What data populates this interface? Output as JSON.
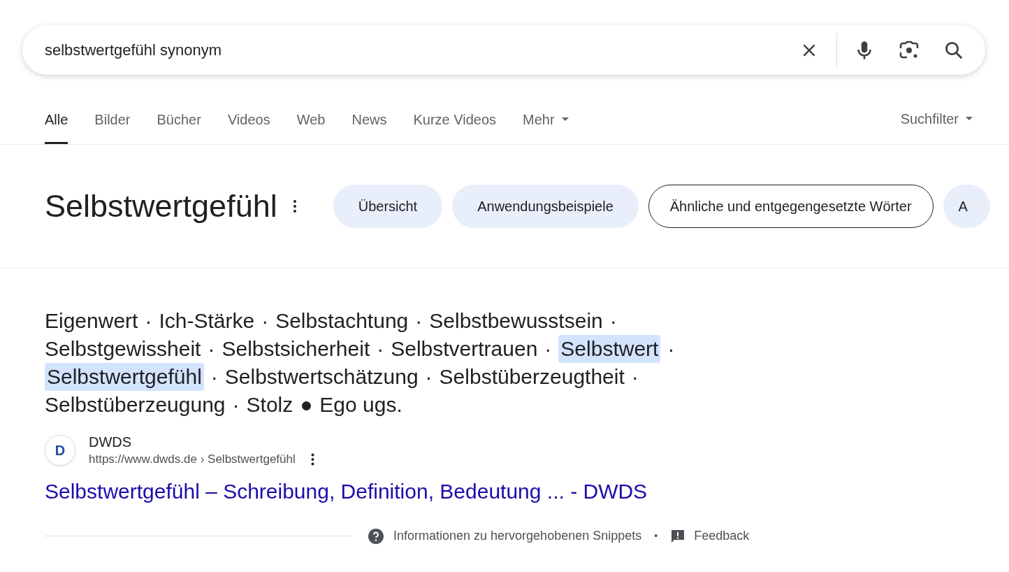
{
  "search": {
    "value": "selbstwertgefühl synonym"
  },
  "tabs": [
    {
      "label": "Alle",
      "selected": true
    },
    {
      "label": "Bilder",
      "selected": false
    },
    {
      "label": "Bücher",
      "selected": false
    },
    {
      "label": "Videos",
      "selected": false
    },
    {
      "label": "Web",
      "selected": false
    },
    {
      "label": "News",
      "selected": false
    },
    {
      "label": "Kurze Videos",
      "selected": false
    },
    {
      "label": "Mehr",
      "selected": false,
      "dropdown": true
    }
  ],
  "filter": {
    "label": "Suchfilter"
  },
  "heading": {
    "title": "Selbstwertgefühl"
  },
  "chips": [
    {
      "label": "Übersicht",
      "selected": false
    },
    {
      "label": "Anwendungsbeispiele",
      "selected": false
    },
    {
      "label": "Ähnliche und entgegengesetzte Wörter",
      "selected": true
    },
    {
      "label": "A",
      "selected": false
    }
  ],
  "synonyms": [
    {
      "word": "Eigenwert",
      "highlighted": false,
      "separator": "·"
    },
    {
      "word": "Ich-Stärke",
      "highlighted": false,
      "separator": "·"
    },
    {
      "word": "Selbstachtung",
      "highlighted": false,
      "separator": "·"
    },
    {
      "word": "Selbstbewusstsein",
      "highlighted": false,
      "separator": "·"
    },
    {
      "word": "Selbstgewissheit",
      "highlighted": false,
      "separator": "·"
    },
    {
      "word": "Selbstsicherheit",
      "highlighted": false,
      "separator": "·"
    },
    {
      "word": "Selbstvertrauen",
      "highlighted": false,
      "separator": "·"
    },
    {
      "word": "Selbstwert",
      "highlighted": true,
      "separator": "·"
    },
    {
      "word": "Selbstwertgefühl",
      "highlighted": true,
      "separator": "·"
    },
    {
      "word": "Selbstwertschätzung",
      "highlighted": false,
      "separator": "·"
    },
    {
      "word": "Selbstüberzeugtheit",
      "highlighted": false,
      "separator": "·"
    },
    {
      "word": "Selbstüberzeugung",
      "highlighted": false,
      "separator": "·"
    },
    {
      "word": "Stolz",
      "highlighted": false,
      "separator": "●"
    },
    {
      "word": "Ego ugs.",
      "highlighted": false
    }
  ],
  "source": {
    "favicon_letter": "D",
    "name": "DWDS",
    "url": "https://www.dwds.de › Selbstwertgefühl",
    "title": "Selbstwertgefühl – Schreibung, Definition, Bedeutung ... - DWDS"
  },
  "footer": {
    "info": "Informationen zu hervorgehobenen Snippets",
    "separator": "•",
    "feedback": "Feedback"
  }
}
